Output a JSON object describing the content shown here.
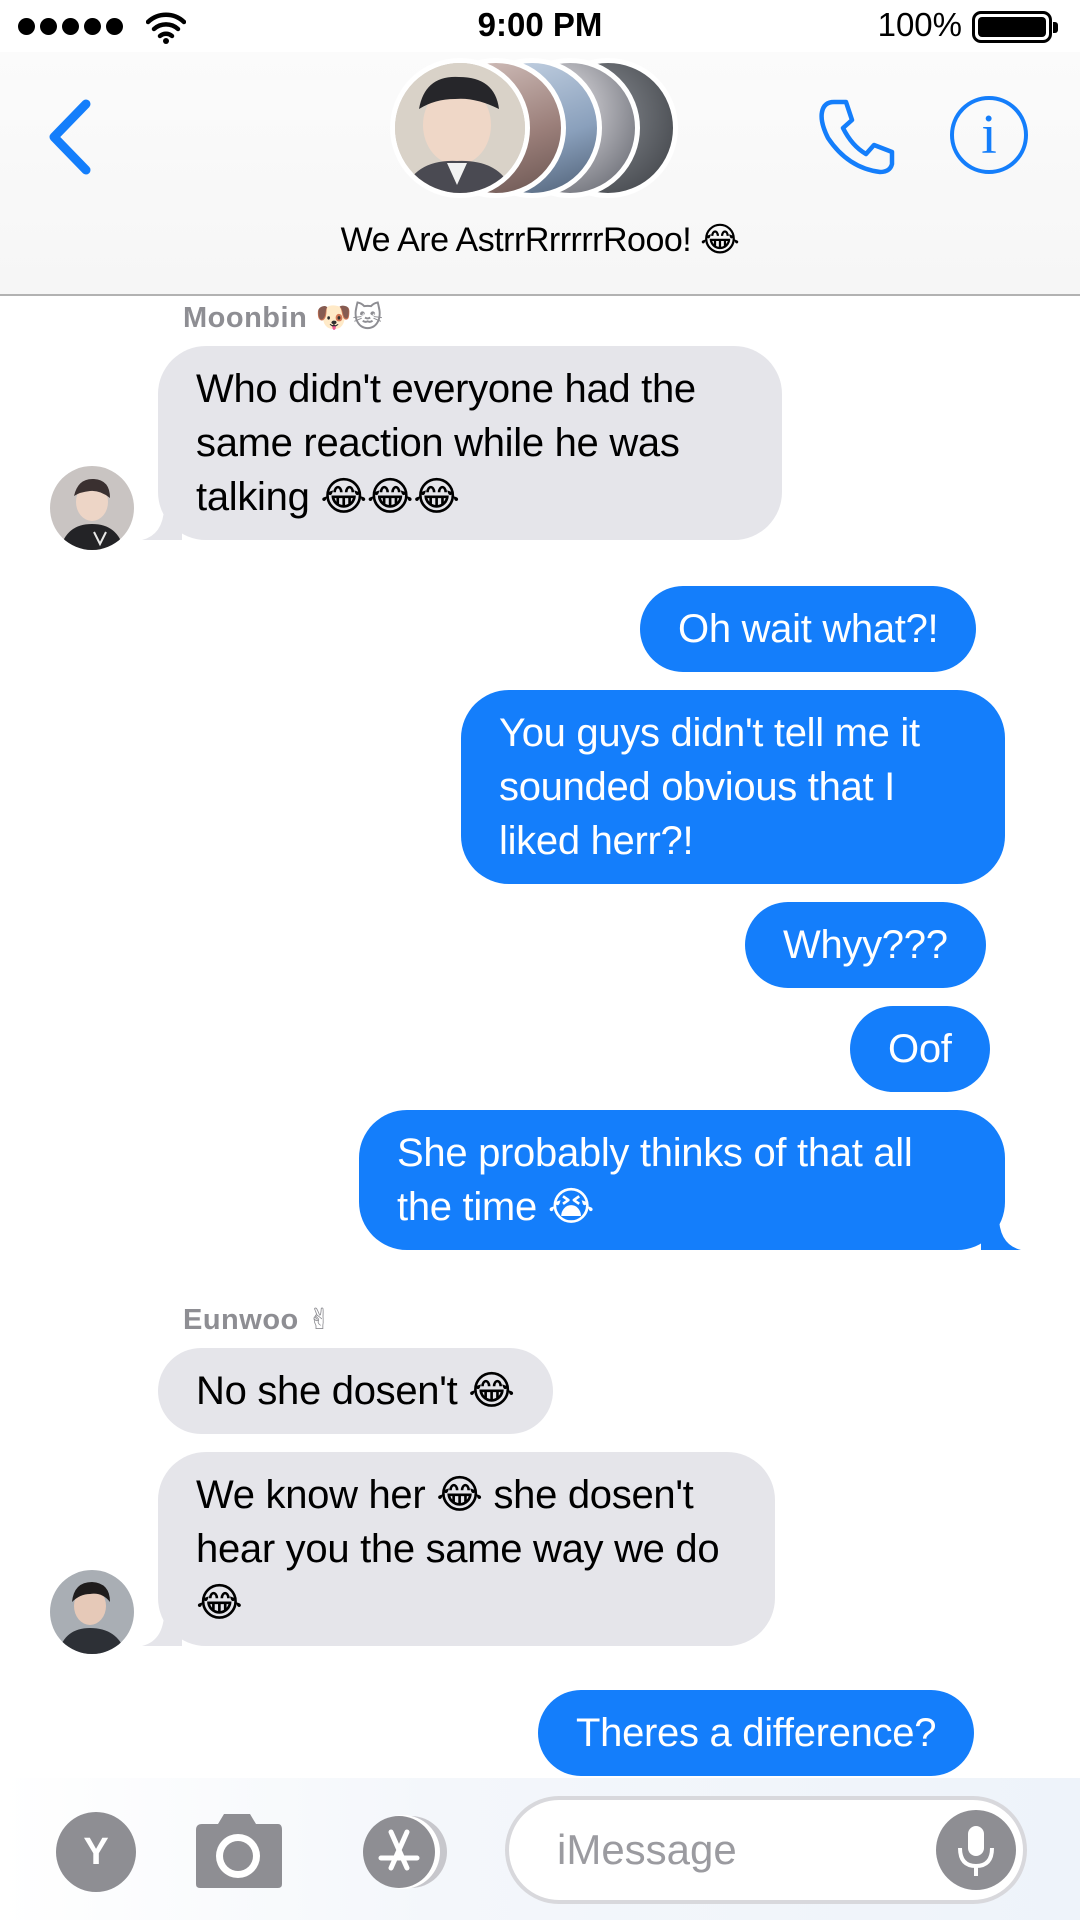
{
  "status_bar": {
    "time": "9:00 PM",
    "battery": "100%"
  },
  "header": {
    "group_name": "We Are AstrrRrrrrrRooo! 😂"
  },
  "messages": {
    "m1": {
      "sender": "Moonbin 🐶🐱",
      "text": "Who didn't everyone had the same reaction while he was talking 😂😂😂"
    },
    "m2": {
      "text": "Oh wait what?!"
    },
    "m3": {
      "text": "You guys didn't tell me it sounded obvious that I liked herr?!"
    },
    "m4": {
      "text": "Whyy???"
    },
    "m5": {
      "text": "Oof"
    },
    "m6": {
      "text": "She probably thinks of that all the time 😭"
    },
    "m7": {
      "sender": "Eunwoo ✌",
      "text": "No she dosen't 😂"
    },
    "m8": {
      "text": "We know her 😂 she dosen't hear you the same way we do 😂"
    },
    "m9": {
      "text": "Theres a difference?"
    }
  },
  "input_bar": {
    "memoji_label": "Y",
    "placeholder": "iMessage"
  },
  "colors": {
    "accent": "#147efb",
    "incoming_bubble": "#e5e5ea",
    "secondary_text": "#8e8e93"
  }
}
